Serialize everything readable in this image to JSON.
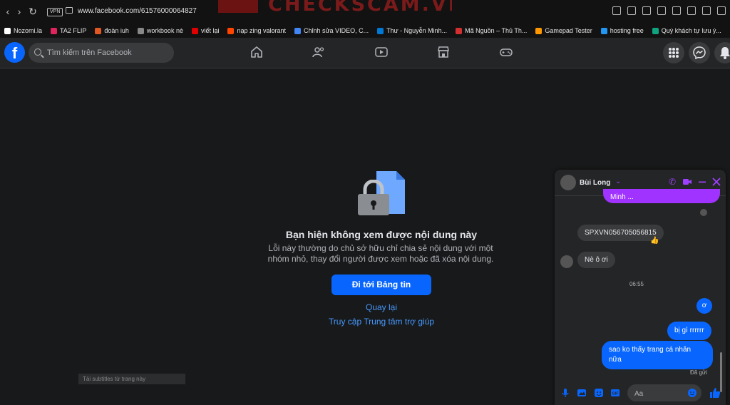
{
  "browser": {
    "url": "www.facebook.com/61576000064827",
    "vpn_label": "VPN",
    "watermark_text": "CHECKSCAM.VN",
    "bookmarks": [
      {
        "label": "Nozomi.la",
        "color": "#ffffff"
      },
      {
        "label": "TA2 FLIP",
        "color": "#e0245e"
      },
      {
        "label": "đoàn iuh",
        "color": "#e25822"
      },
      {
        "label": "workbook nè",
        "color": "#888888"
      },
      {
        "label": "viết lại",
        "color": "#e00000"
      },
      {
        "label": "nạp zing valorant",
        "color": "#ff4500"
      },
      {
        "label": "Chỉnh sửa VIDEO, C...",
        "color": "#4285f4"
      },
      {
        "label": "Thư - Nguyễn Minh...",
        "color": "#0078d4"
      },
      {
        "label": "Mã Nguồn – Thủ Th...",
        "color": "#d32f2f"
      },
      {
        "label": "Gamepad Tester",
        "color": "#ff9800"
      },
      {
        "label": "hosting free",
        "color": "#2196f3"
      },
      {
        "label": "Quý khách tự lưu ý...",
        "color": "#10a37f"
      }
    ]
  },
  "facebook": {
    "logo": "f",
    "search_placeholder": "Tìm kiếm trên Facebook",
    "accent_color": "#0866ff",
    "nav_icons": [
      "home-icon",
      "friends-icon",
      "video-icon",
      "marketplace-icon",
      "gaming-icon"
    ],
    "right_icons": [
      "menu-grid-icon",
      "messenger-icon",
      "notifications-icon"
    ]
  },
  "error_page": {
    "title": "Bạn hiện không xem được nội dung này",
    "description_line1": "Lỗi này thường do chủ sở hữu chỉ chia sẻ nội dung với một",
    "description_line2": "nhóm nhỏ, thay đổi người được xem hoặc đã xóa nội dung.",
    "primary_button": "Đi tới Bảng tin",
    "back_link": "Quay lại",
    "help_link": "Truy cập Trung tâm trợ giúp"
  },
  "subtitle_bar": "Tải subtitles từ trang này",
  "chat": {
    "contact_name": "Bùi Long",
    "messages": {
      "partial_sent": "Minh ...",
      "code": "SPXVN056705056815",
      "reaction": "👍",
      "them_greeting": "Nè ô ơi",
      "time": "06:55",
      "me_1": "ơ",
      "me_2": "bị gì rrrrrr",
      "me_3_line1": "sao ko thấy trang cá nhân",
      "me_3_line2": "nữa",
      "status": "Đã gửi"
    },
    "composer_placeholder": "Aa",
    "accent_color": "#a033ff"
  }
}
